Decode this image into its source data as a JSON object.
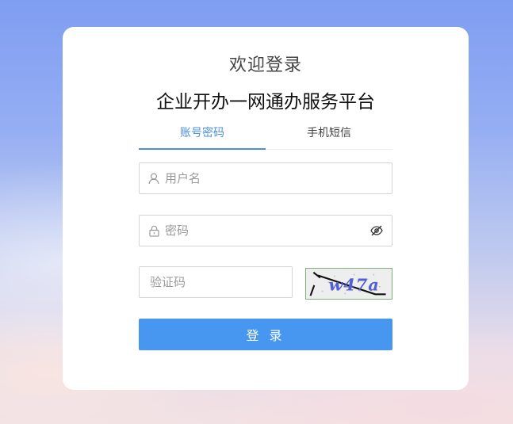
{
  "header": {
    "welcome": "欢迎登录",
    "platform_name": "企业开办一网通办服务平台"
  },
  "tabs": [
    {
      "label": "账号密码",
      "active": true
    },
    {
      "label": "手机短信",
      "active": false
    }
  ],
  "form": {
    "username": {
      "placeholder": "用户名",
      "value": "",
      "icon": "user-icon"
    },
    "password": {
      "placeholder": "密码",
      "value": "",
      "icon": "lock-icon",
      "toggle_icon": "eye-slash-icon"
    },
    "captcha": {
      "placeholder": "验证码",
      "value": "",
      "image_text": "w47a"
    }
  },
  "login_button": {
    "label": "登 录"
  },
  "colors": {
    "accent": "#4a90e2",
    "button": "#4796f0",
    "captcha_border": "#7fb07a"
  }
}
